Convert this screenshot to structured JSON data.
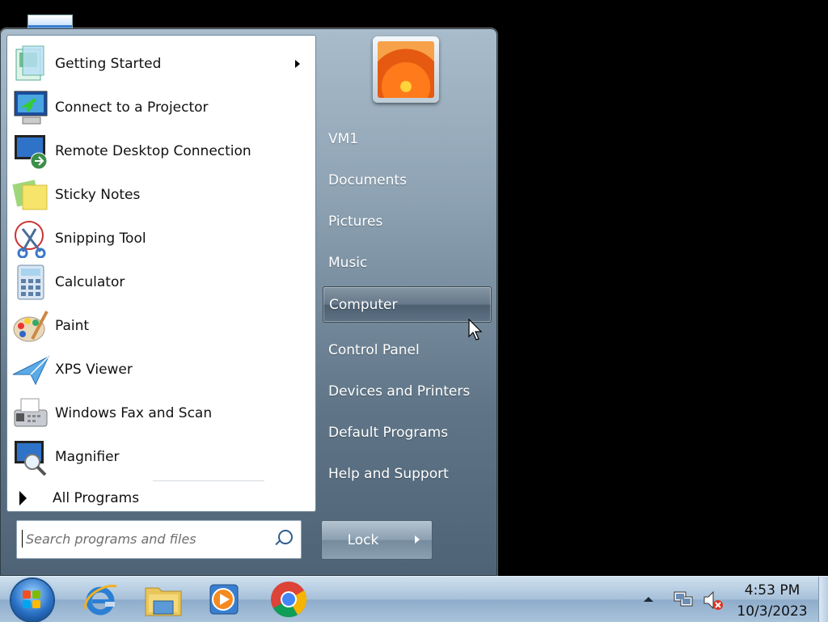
{
  "start_menu": {
    "programs": [
      {
        "label": "Getting Started",
        "icon": "getting-started-icon",
        "has_submenu": true
      },
      {
        "label": "Connect to a Projector",
        "icon": "projector-icon"
      },
      {
        "label": "Remote Desktop Connection",
        "icon": "remote-desktop-icon"
      },
      {
        "label": "Sticky Notes",
        "icon": "sticky-notes-icon"
      },
      {
        "label": "Snipping Tool",
        "icon": "snipping-tool-icon"
      },
      {
        "label": "Calculator",
        "icon": "calculator-icon"
      },
      {
        "label": "Paint",
        "icon": "paint-icon"
      },
      {
        "label": "XPS Viewer",
        "icon": "xps-viewer-icon"
      },
      {
        "label": "Windows Fax and Scan",
        "icon": "fax-scan-icon"
      },
      {
        "label": "Magnifier",
        "icon": "magnifier-icon"
      }
    ],
    "all_programs_label": "All Programs",
    "search": {
      "placeholder": "Search programs and files"
    },
    "right_items": [
      {
        "label": "VM1"
      },
      {
        "label": "Documents"
      },
      {
        "label": "Pictures"
      },
      {
        "label": "Music"
      },
      {
        "label": "Computer",
        "hovered": true
      },
      {
        "label": "Control Panel"
      },
      {
        "label": "Devices and Printers"
      },
      {
        "label": "Default Programs"
      },
      {
        "label": "Help and Support"
      }
    ],
    "lock_label": "Lock"
  },
  "taskbar": {
    "pinned": [
      "internet-explorer-icon",
      "windows-explorer-icon",
      "media-player-icon",
      "chrome-icon"
    ],
    "clock_time": "4:53 PM",
    "clock_date": "10/3/2023"
  }
}
